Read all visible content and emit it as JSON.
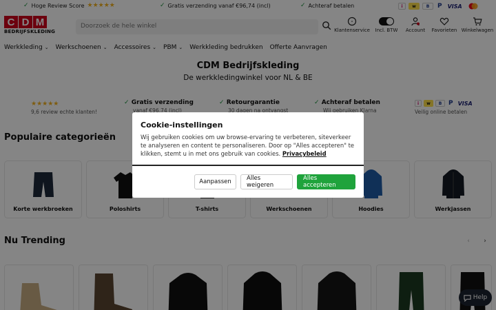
{
  "topbar": {
    "review_label": "Hoge Review Score",
    "shipping_label": "Gratis verzending vanaf €96,74 (incl)",
    "afterpay_label": "Achteraf betalen",
    "payment_logos": [
      "iDEAL",
      "WERO",
      "Bancontact",
      "PayPal",
      "VISA",
      "Mastercard"
    ]
  },
  "header": {
    "logo_letters": [
      "C",
      "D",
      "M"
    ],
    "logo_sub": "BEDRIJFSKLEDING",
    "search_placeholder": "Doorzoek de hele winkel",
    "icons": [
      {
        "name": "klantenservice",
        "label": "Klantenservice"
      },
      {
        "name": "btw-toggle",
        "label": "Incl. BTW"
      },
      {
        "name": "account",
        "label": "Account"
      },
      {
        "name": "favorieten",
        "label": "Favorieten"
      },
      {
        "name": "winkelwagen",
        "label": "Winkelwagen"
      }
    ]
  },
  "nav": {
    "items": [
      "Werkkleding",
      "Werkschoenen",
      "Accessoires",
      "PBM",
      "Werkkleding bedrukken",
      "Offerte Aanvragen"
    ]
  },
  "hero": {
    "title": "CDM Bedrijfskleding",
    "subtitle": "De werkkledingwinkel voor NL & BE"
  },
  "usps": [
    {
      "title": "",
      "sub": "9,6 review echte klanten!"
    },
    {
      "title": "Gratis verzending",
      "sub": "vanaf €96,74 (incl)"
    },
    {
      "title": "Retourgarantie",
      "sub": "30 dagen na ontvangst"
    },
    {
      "title": "Achteraf betalen",
      "sub": "Wij gebruiken Klarna"
    },
    {
      "title": "",
      "sub": "Veilig online betalen"
    }
  ],
  "sections": {
    "categories_title": "Populaire categorieën",
    "trending_title": "Nu Trending"
  },
  "categories": [
    "Korte werkbroeken",
    "Poloshirts",
    "T-shirts",
    "Werkschoenen",
    "Hoodies",
    "Werkjassen"
  ],
  "help_label": "Help",
  "cookie": {
    "title": "Cookie-instellingen",
    "text": "Wij gebruiken cookies om uw browse-ervaring te verbeteren, siteverkeer te analyseren en content te personaliseren. Door op \"Alles accepteren\" te klikken, stemt u in met ons gebruik van cookies.",
    "link": "Privacybeleid",
    "btn_customize": "Aanpassen",
    "btn_reject": "Alles weigeren",
    "btn_accept": "Alles accepteren"
  },
  "colors": {
    "brand_red": "#d0021b",
    "accept_green": "#1fa33c",
    "check_green": "#1a8f3a",
    "star_yellow": "#f2b01e"
  }
}
